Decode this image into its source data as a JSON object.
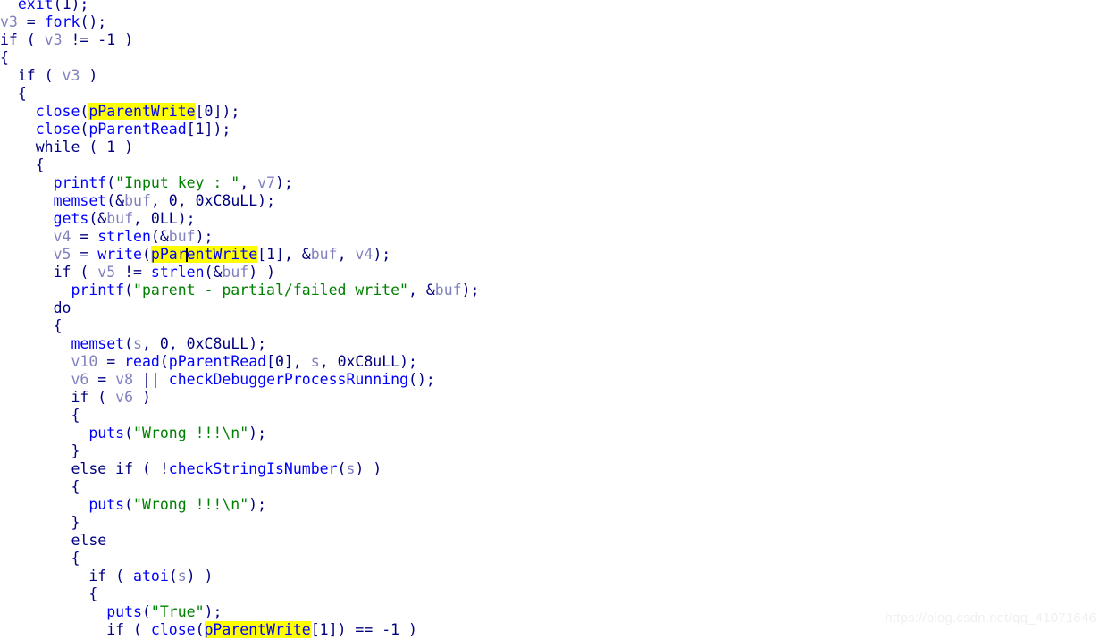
{
  "editor": {
    "kind": "ida-pseudocode-view",
    "background_color": "#ffffff",
    "highlight_color": "#ffff00",
    "caret_color": "#000000",
    "colors": {
      "keyword": "#000080",
      "function": "#0000ff",
      "string": "#008000",
      "variable": "#8080c0",
      "number": "#000080"
    },
    "highlighted_identifier": "pParentWrite",
    "caret": {
      "line_index": 11,
      "inside_identifier": "pParentWrite",
      "chars_before": 4
    }
  },
  "watermark": {
    "text": "https://blog.csdn.net/qq_41071646"
  },
  "code": {
    "lines": [
      {
        "indent": 2,
        "tokens": [
          {
            "t": "func",
            "v": "exit"
          },
          {
            "t": "punct",
            "v": "("
          },
          {
            "t": "num",
            "v": "1"
          },
          {
            "t": "punct",
            "v": ");"
          }
        ]
      },
      {
        "indent": 0,
        "tokens": [
          {
            "t": "var",
            "v": "v3"
          },
          {
            "t": "punct",
            "v": " = "
          },
          {
            "t": "func",
            "v": "fork"
          },
          {
            "t": "punct",
            "v": "();"
          }
        ]
      },
      {
        "indent": 0,
        "tokens": [
          {
            "t": "kw",
            "v": "if ( "
          },
          {
            "t": "var",
            "v": "v3"
          },
          {
            "t": "punct",
            "v": " != -1 )"
          }
        ]
      },
      {
        "indent": 0,
        "tokens": [
          {
            "t": "punct",
            "v": "{"
          }
        ]
      },
      {
        "indent": 2,
        "tokens": [
          {
            "t": "kw",
            "v": "if ( "
          },
          {
            "t": "var",
            "v": "v3"
          },
          {
            "t": "punct",
            "v": " )"
          }
        ]
      },
      {
        "indent": 2,
        "tokens": [
          {
            "t": "punct",
            "v": "{"
          }
        ]
      },
      {
        "indent": 4,
        "tokens": [
          {
            "t": "func",
            "v": "close"
          },
          {
            "t": "punct",
            "v": "("
          },
          {
            "t": "glob",
            "v": "pParentWrite",
            "hl": true
          },
          {
            "t": "punct",
            "v": "[0]);"
          }
        ]
      },
      {
        "indent": 4,
        "tokens": [
          {
            "t": "func",
            "v": "close"
          },
          {
            "t": "punct",
            "v": "("
          },
          {
            "t": "glob",
            "v": "pParentRead"
          },
          {
            "t": "punct",
            "v": "[1]);"
          }
        ]
      },
      {
        "indent": 4,
        "tokens": [
          {
            "t": "kw",
            "v": "while ( "
          },
          {
            "t": "num",
            "v": "1"
          },
          {
            "t": "punct",
            "v": " )"
          }
        ]
      },
      {
        "indent": 4,
        "tokens": [
          {
            "t": "punct",
            "v": "{"
          }
        ]
      },
      {
        "indent": 6,
        "tokens": [
          {
            "t": "func",
            "v": "printf"
          },
          {
            "t": "punct",
            "v": "("
          },
          {
            "t": "str",
            "v": "\"Input key : \""
          },
          {
            "t": "punct",
            "v": ", "
          },
          {
            "t": "var",
            "v": "v7"
          },
          {
            "t": "punct",
            "v": ");"
          }
        ]
      },
      {
        "indent": 6,
        "tokens": [
          {
            "t": "func",
            "v": "memset"
          },
          {
            "t": "punct",
            "v": "(&"
          },
          {
            "t": "var",
            "v": "buf"
          },
          {
            "t": "punct",
            "v": ", "
          },
          {
            "t": "num",
            "v": "0"
          },
          {
            "t": "punct",
            "v": ", "
          },
          {
            "t": "num",
            "v": "0xC8uLL"
          },
          {
            "t": "punct",
            "v": ");"
          }
        ]
      },
      {
        "indent": 6,
        "tokens": [
          {
            "t": "func",
            "v": "gets"
          },
          {
            "t": "punct",
            "v": "(&"
          },
          {
            "t": "var",
            "v": "buf"
          },
          {
            "t": "punct",
            "v": ", "
          },
          {
            "t": "num",
            "v": "0LL"
          },
          {
            "t": "punct",
            "v": ");"
          }
        ]
      },
      {
        "indent": 6,
        "tokens": [
          {
            "t": "var",
            "v": "v4"
          },
          {
            "t": "punct",
            "v": " = "
          },
          {
            "t": "func",
            "v": "strlen"
          },
          {
            "t": "punct",
            "v": "(&"
          },
          {
            "t": "var",
            "v": "buf"
          },
          {
            "t": "punct",
            "v": ");"
          }
        ]
      },
      {
        "indent": 6,
        "caret_after": 4,
        "tokens": [
          {
            "t": "var",
            "v": "v5"
          },
          {
            "t": "punct",
            "v": " = "
          },
          {
            "t": "func",
            "v": "write"
          },
          {
            "t": "punct",
            "v": "("
          },
          {
            "t": "glob",
            "v": "pParentWrite",
            "hl": true,
            "caret": 4
          },
          {
            "t": "punct",
            "v": "[1], &"
          },
          {
            "t": "var",
            "v": "buf"
          },
          {
            "t": "punct",
            "v": ", "
          },
          {
            "t": "var",
            "v": "v4"
          },
          {
            "t": "punct",
            "v": ");"
          }
        ]
      },
      {
        "indent": 6,
        "tokens": [
          {
            "t": "kw",
            "v": "if ( "
          },
          {
            "t": "var",
            "v": "v5"
          },
          {
            "t": "punct",
            "v": " != "
          },
          {
            "t": "func",
            "v": "strlen"
          },
          {
            "t": "punct",
            "v": "(&"
          },
          {
            "t": "var",
            "v": "buf"
          },
          {
            "t": "punct",
            "v": ") )"
          }
        ]
      },
      {
        "indent": 8,
        "tokens": [
          {
            "t": "func",
            "v": "printf"
          },
          {
            "t": "punct",
            "v": "("
          },
          {
            "t": "str",
            "v": "\"parent - partial/failed write\""
          },
          {
            "t": "punct",
            "v": ", &"
          },
          {
            "t": "var",
            "v": "buf"
          },
          {
            "t": "punct",
            "v": ");"
          }
        ]
      },
      {
        "indent": 6,
        "tokens": [
          {
            "t": "kw",
            "v": "do"
          }
        ]
      },
      {
        "indent": 6,
        "tokens": [
          {
            "t": "punct",
            "v": "{"
          }
        ]
      },
      {
        "indent": 8,
        "tokens": [
          {
            "t": "func",
            "v": "memset"
          },
          {
            "t": "punct",
            "v": "("
          },
          {
            "t": "var",
            "v": "s"
          },
          {
            "t": "punct",
            "v": ", "
          },
          {
            "t": "num",
            "v": "0"
          },
          {
            "t": "punct",
            "v": ", "
          },
          {
            "t": "num",
            "v": "0xC8uLL"
          },
          {
            "t": "punct",
            "v": ");"
          }
        ]
      },
      {
        "indent": 8,
        "tokens": [
          {
            "t": "var",
            "v": "v10"
          },
          {
            "t": "punct",
            "v": " = "
          },
          {
            "t": "func",
            "v": "read"
          },
          {
            "t": "punct",
            "v": "("
          },
          {
            "t": "glob",
            "v": "pParentRead"
          },
          {
            "t": "punct",
            "v": "[0], "
          },
          {
            "t": "var",
            "v": "s"
          },
          {
            "t": "punct",
            "v": ", "
          },
          {
            "t": "num",
            "v": "0xC8uLL"
          },
          {
            "t": "punct",
            "v": ");"
          }
        ]
      },
      {
        "indent": 8,
        "tokens": [
          {
            "t": "var",
            "v": "v6"
          },
          {
            "t": "punct",
            "v": " = "
          },
          {
            "t": "var",
            "v": "v8"
          },
          {
            "t": "punct",
            "v": " || "
          },
          {
            "t": "func",
            "v": "checkDebuggerProcessRunning"
          },
          {
            "t": "punct",
            "v": "();"
          }
        ]
      },
      {
        "indent": 8,
        "tokens": [
          {
            "t": "kw",
            "v": "if ( "
          },
          {
            "t": "var",
            "v": "v6"
          },
          {
            "t": "punct",
            "v": " )"
          }
        ]
      },
      {
        "indent": 8,
        "tokens": [
          {
            "t": "punct",
            "v": "{"
          }
        ]
      },
      {
        "indent": 10,
        "tokens": [
          {
            "t": "func",
            "v": "puts"
          },
          {
            "t": "punct",
            "v": "("
          },
          {
            "t": "str",
            "v": "\"Wrong !!!\\n\""
          },
          {
            "t": "punct",
            "v": ");"
          }
        ]
      },
      {
        "indent": 8,
        "tokens": [
          {
            "t": "punct",
            "v": "}"
          }
        ]
      },
      {
        "indent": 8,
        "tokens": [
          {
            "t": "kw",
            "v": "else if ( !"
          },
          {
            "t": "func",
            "v": "checkStringIsNumber"
          },
          {
            "t": "punct",
            "v": "("
          },
          {
            "t": "var",
            "v": "s"
          },
          {
            "t": "punct",
            "v": ") )"
          }
        ]
      },
      {
        "indent": 8,
        "tokens": [
          {
            "t": "punct",
            "v": "{"
          }
        ]
      },
      {
        "indent": 10,
        "tokens": [
          {
            "t": "func",
            "v": "puts"
          },
          {
            "t": "punct",
            "v": "("
          },
          {
            "t": "str",
            "v": "\"Wrong !!!\\n\""
          },
          {
            "t": "punct",
            "v": ");"
          }
        ]
      },
      {
        "indent": 8,
        "tokens": [
          {
            "t": "punct",
            "v": "}"
          }
        ]
      },
      {
        "indent": 8,
        "tokens": [
          {
            "t": "kw",
            "v": "else"
          }
        ]
      },
      {
        "indent": 8,
        "tokens": [
          {
            "t": "punct",
            "v": "{"
          }
        ]
      },
      {
        "indent": 10,
        "tokens": [
          {
            "t": "kw",
            "v": "if ( "
          },
          {
            "t": "func",
            "v": "atoi"
          },
          {
            "t": "punct",
            "v": "("
          },
          {
            "t": "var",
            "v": "s"
          },
          {
            "t": "punct",
            "v": ") )"
          }
        ]
      },
      {
        "indent": 10,
        "tokens": [
          {
            "t": "punct",
            "v": "{"
          }
        ]
      },
      {
        "indent": 12,
        "tokens": [
          {
            "t": "func",
            "v": "puts"
          },
          {
            "t": "punct",
            "v": "("
          },
          {
            "t": "str",
            "v": "\"True\""
          },
          {
            "t": "punct",
            "v": ");"
          }
        ]
      },
      {
        "indent": 12,
        "tokens": [
          {
            "t": "kw",
            "v": "if ( "
          },
          {
            "t": "func",
            "v": "close"
          },
          {
            "t": "punct",
            "v": "("
          },
          {
            "t": "glob",
            "v": "pParentWrite",
            "hl": true
          },
          {
            "t": "punct",
            "v": "[1]) == -1 )"
          }
        ]
      }
    ]
  }
}
